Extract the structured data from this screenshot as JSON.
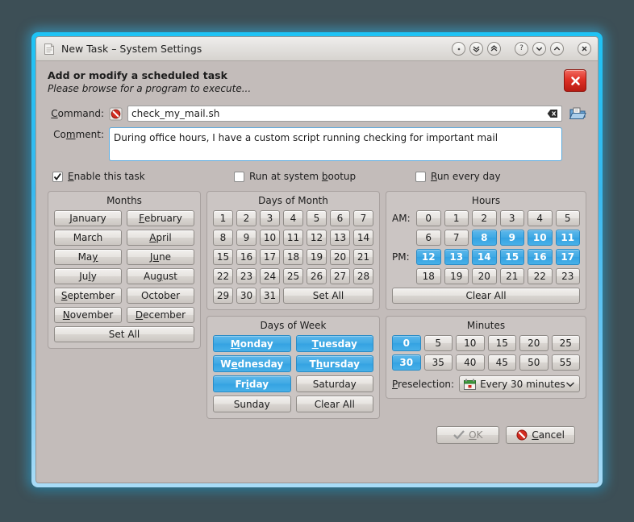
{
  "window": {
    "title": "New Task – System Settings",
    "title_icon": "document-icon",
    "buttons": [
      {
        "name": "minimize-dot-button",
        "glyph": "·"
      },
      {
        "name": "shade-down-button",
        "glyph": "»"
      },
      {
        "name": "shade-up-button",
        "glyph": "«"
      },
      {
        "name": "help-button",
        "glyph": "?"
      },
      {
        "name": "menu-down-button",
        "glyph": "˅"
      },
      {
        "name": "menu-up-button",
        "glyph": "˄"
      },
      {
        "name": "close-button",
        "glyph": "✕"
      }
    ]
  },
  "header": {
    "title": "Add or modify a scheduled task",
    "subtitle": "Please browse for a program to execute...",
    "error_badge_icon": "error-close-icon"
  },
  "form": {
    "command_label": "Command:",
    "command_label_accel": "C",
    "command_status_icon": "forbidden-icon",
    "command_value": "check_my_mail.sh",
    "command_clear_icon": "clear-text-icon",
    "browse_icon": "browse-folder-icon",
    "comment_label": "Comment:",
    "comment_label_accel": "m",
    "comment_value": "During office hours, I have a custom script running checking for important mail"
  },
  "checkboxes": [
    {
      "name": "enable-this-task",
      "label": "Enable this task",
      "accel": "E",
      "checked": true
    },
    {
      "name": "run-at-system-bootup",
      "label": "Run at system bootup",
      "accel": "b",
      "checked": false
    },
    {
      "name": "run-every-day",
      "label": "Run every day",
      "accel": "R",
      "checked": false
    }
  ],
  "months": {
    "title": "Months",
    "items": [
      {
        "label": "January",
        "accel": "J",
        "selected": false
      },
      {
        "label": "February",
        "accel": "F",
        "selected": false
      },
      {
        "label": "March",
        "accel": "",
        "selected": false
      },
      {
        "label": "April",
        "accel": "A",
        "selected": false
      },
      {
        "label": "May",
        "accel": "y",
        "selected": false
      },
      {
        "label": "June",
        "accel": "u",
        "selected": false
      },
      {
        "label": "July",
        "accel": "l",
        "selected": false
      },
      {
        "label": "August",
        "accel": "g",
        "selected": false
      },
      {
        "label": "September",
        "accel": "S",
        "selected": false
      },
      {
        "label": "October",
        "accel": "",
        "selected": false
      },
      {
        "label": "November",
        "accel": "N",
        "selected": false
      },
      {
        "label": "December",
        "accel": "D",
        "selected": false
      }
    ],
    "set_all": "Set All"
  },
  "days_of_month": {
    "title": "Days of Month",
    "items": [
      {
        "label": "1",
        "selected": false
      },
      {
        "label": "2",
        "selected": false
      },
      {
        "label": "3",
        "selected": false
      },
      {
        "label": "4",
        "selected": false
      },
      {
        "label": "5",
        "selected": false
      },
      {
        "label": "6",
        "selected": false
      },
      {
        "label": "7",
        "selected": false
      },
      {
        "label": "8",
        "selected": false
      },
      {
        "label": "9",
        "selected": false
      },
      {
        "label": "10",
        "selected": false
      },
      {
        "label": "11",
        "selected": false
      },
      {
        "label": "12",
        "selected": false
      },
      {
        "label": "13",
        "selected": false
      },
      {
        "label": "14",
        "selected": false
      },
      {
        "label": "15",
        "selected": false
      },
      {
        "label": "16",
        "selected": false
      },
      {
        "label": "17",
        "selected": false
      },
      {
        "label": "18",
        "selected": false
      },
      {
        "label": "19",
        "selected": false
      },
      {
        "label": "20",
        "selected": false
      },
      {
        "label": "21",
        "selected": false
      },
      {
        "label": "22",
        "selected": false
      },
      {
        "label": "23",
        "selected": false
      },
      {
        "label": "24",
        "selected": false
      },
      {
        "label": "25",
        "selected": false
      },
      {
        "label": "26",
        "selected": false
      },
      {
        "label": "27",
        "selected": false
      },
      {
        "label": "28",
        "selected": false
      },
      {
        "label": "29",
        "selected": false
      },
      {
        "label": "30",
        "selected": false
      },
      {
        "label": "31",
        "selected": false
      }
    ],
    "set_all": "Set All"
  },
  "hours": {
    "title": "Hours",
    "am_label": "AM:",
    "pm_label": "PM:",
    "rows": [
      {
        "cells": [
          {
            "label": "0",
            "selected": false
          },
          {
            "label": "1",
            "selected": false
          },
          {
            "label": "2",
            "selected": false
          },
          {
            "label": "3",
            "selected": false
          },
          {
            "label": "4",
            "selected": false
          },
          {
            "label": "5",
            "selected": false
          }
        ]
      },
      {
        "cells": [
          {
            "label": "6",
            "selected": false
          },
          {
            "label": "7",
            "selected": false
          },
          {
            "label": "8",
            "selected": true
          },
          {
            "label": "9",
            "selected": true
          },
          {
            "label": "10",
            "selected": true
          },
          {
            "label": "11",
            "selected": true
          }
        ]
      },
      {
        "cells": [
          {
            "label": "12",
            "selected": true
          },
          {
            "label": "13",
            "selected": true
          },
          {
            "label": "14",
            "selected": true
          },
          {
            "label": "15",
            "selected": true
          },
          {
            "label": "16",
            "selected": true
          },
          {
            "label": "17",
            "selected": true
          }
        ]
      },
      {
        "cells": [
          {
            "label": "18",
            "selected": false
          },
          {
            "label": "19",
            "selected": false
          },
          {
            "label": "20",
            "selected": false
          },
          {
            "label": "21",
            "selected": false
          },
          {
            "label": "22",
            "selected": false
          },
          {
            "label": "23",
            "selected": false
          }
        ]
      }
    ],
    "clear_all": "Clear All"
  },
  "days_of_week": {
    "title": "Days of Week",
    "items": [
      {
        "label": "Monday",
        "accel": "M",
        "selected": true
      },
      {
        "label": "Tuesday",
        "accel": "T",
        "selected": true
      },
      {
        "label": "Wednesday",
        "accel": "e",
        "selected": true
      },
      {
        "label": "Thursday",
        "accel": "h",
        "selected": true
      },
      {
        "label": "Friday",
        "accel": "i",
        "selected": true
      },
      {
        "label": "Saturday",
        "accel": "",
        "selected": false
      },
      {
        "label": "Sunday",
        "accel": "",
        "selected": false
      }
    ],
    "clear_all": "Clear All"
  },
  "minutes": {
    "title": "Minutes",
    "items": [
      {
        "label": "0",
        "selected": true
      },
      {
        "label": "5",
        "selected": false
      },
      {
        "label": "10",
        "selected": false
      },
      {
        "label": "15",
        "selected": false
      },
      {
        "label": "20",
        "selected": false
      },
      {
        "label": "25",
        "selected": false
      },
      {
        "label": "30",
        "selected": true
      },
      {
        "label": "35",
        "selected": false
      },
      {
        "label": "40",
        "selected": false
      },
      {
        "label": "45",
        "selected": false
      },
      {
        "label": "50",
        "selected": false
      },
      {
        "label": "55",
        "selected": false
      }
    ],
    "preselection_label": "Preselection:",
    "preselection_accel": "P",
    "preselection_value": "Every 30 minutes",
    "preselection_icon": "calendar-icon",
    "preselection_arrow_icon": "chevron-down-icon"
  },
  "footer": {
    "ok_label": "OK",
    "ok_accel": "O",
    "ok_icon": "check-icon",
    "ok_disabled": true,
    "cancel_label": "Cancel",
    "cancel_accel": "C",
    "cancel_icon": "forbidden-icon"
  },
  "colors": {
    "selected_blue": "#3FA9E4",
    "desktop_bg": "#3D4F56",
    "glow": "#39B9EF",
    "dialog_bg": "#C3BCBA",
    "error_red": "#DF3126"
  }
}
